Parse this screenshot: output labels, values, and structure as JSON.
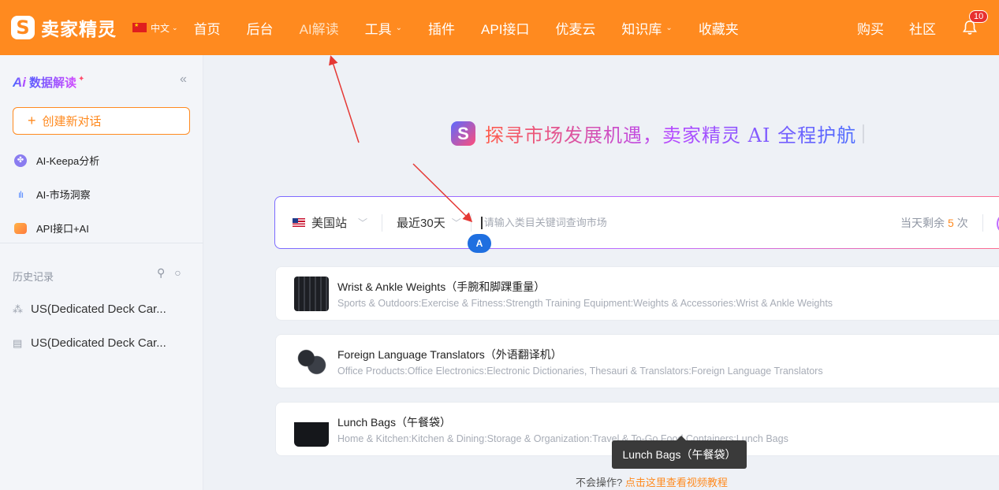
{
  "app": {
    "brand": "卖家精灵",
    "logo_glyph": "S",
    "accent": "#ff8a1f"
  },
  "topbar": {
    "lang": "中文",
    "nav": [
      {
        "label": "首页"
      },
      {
        "label": "后台"
      },
      {
        "label": "AI解读"
      },
      {
        "label": "工具"
      },
      {
        "label": "插件"
      },
      {
        "label": "API接口"
      },
      {
        "label": "优麦云"
      },
      {
        "label": "知识库"
      },
      {
        "label": "收藏夹"
      }
    ],
    "right": [
      {
        "label": "购买"
      },
      {
        "label": "社区"
      }
    ],
    "notifications": "10"
  },
  "sidebar": {
    "title": "数据解读",
    "ai_mark": "Ai",
    "new_chat": "创建新对话",
    "items": [
      {
        "label": "AI-Keepa分析",
        "icon": "keepa-icon"
      },
      {
        "label": "AI-市场洞察",
        "icon": "market-chart-icon"
      },
      {
        "label": "API接口+AI",
        "icon": "api-icon"
      }
    ],
    "history_label": "历史记录",
    "history": [
      {
        "label": "US(Dedicated Deck Car...",
        "icon": "loading-icon"
      },
      {
        "label": "US(Dedicated Deck Car...",
        "icon": "document-icon"
      }
    ]
  },
  "main": {
    "hero": "探寻市场发展机遇，卖家精灵 AI 全程护航",
    "search": {
      "site": "美国站",
      "range": "最近30天",
      "placeholder": "请输入类目关键词查询市场",
      "quota_prefix": "当天剩余",
      "quota_num": "5",
      "quota_suffix": "次"
    },
    "cursor_label": "A",
    "cards": [
      {
        "title": "Wrist & Ankle Weights（手腕和脚踝重量）",
        "path": "Sports & Outdoors:Exercise & Fitness:Strength Training Equipment:Weights & Accessories:Wrist & Ankle Weights"
      },
      {
        "title": "Foreign Language Translators（外语翻译机）",
        "path": "Office Products:Office Electronics:Electronic Dictionaries, Thesauri & Translators:Foreign Language Translators"
      },
      {
        "title": "Lunch Bags（午餐袋）",
        "path": "Home & Kitchen:Kitchen & Dining:Storage & Organization:Travel & To-Go Food Containers:Lunch Bags"
      }
    ],
    "tooltip": "Lunch Bags（午餐袋）",
    "help_prefix": "不会操作?",
    "help_link": "点击这里查看视频教程"
  }
}
